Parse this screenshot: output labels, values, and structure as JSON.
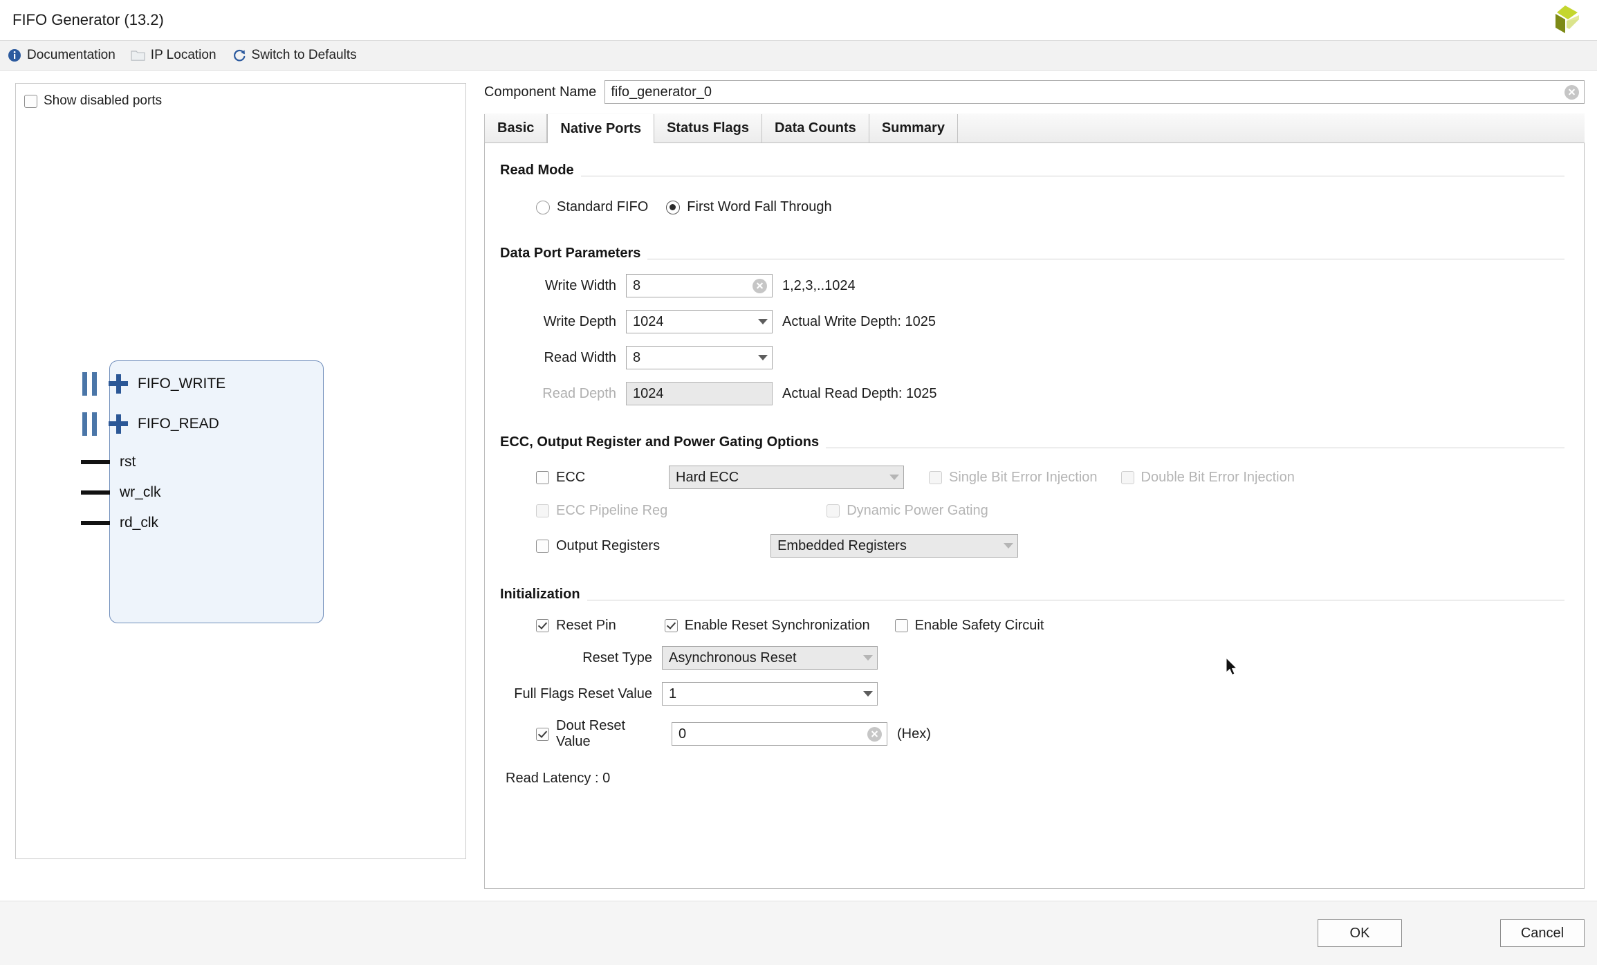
{
  "window": {
    "title": "FIFO Generator (13.2)",
    "logo_name": "xilinx-logo"
  },
  "toolbar": {
    "items": [
      {
        "label": "Documentation",
        "icon": "info-icon"
      },
      {
        "label": "IP Location",
        "icon": "folder-icon"
      },
      {
        "label": "Switch to Defaults",
        "icon": "refresh-icon"
      }
    ]
  },
  "preview": {
    "show_disabled_ports_label": "Show disabled ports",
    "show_disabled_ports_checked": false,
    "ports": [
      {
        "name": "FIFO_WRITE",
        "type": "bus"
      },
      {
        "name": "FIFO_READ",
        "type": "bus"
      },
      {
        "name": "rst",
        "type": "wire"
      },
      {
        "name": "wr_clk",
        "type": "wire"
      },
      {
        "name": "rd_clk",
        "type": "wire"
      }
    ]
  },
  "component": {
    "label": "Component Name",
    "value": "fifo_generator_0",
    "placeholder": "fifo_generator_0"
  },
  "tabs": [
    {
      "label": "Basic",
      "active": false
    },
    {
      "label": "Native Ports",
      "active": true
    },
    {
      "label": "Status Flags",
      "active": false
    },
    {
      "label": "Data Counts",
      "active": false
    },
    {
      "label": "Summary",
      "active": false
    }
  ],
  "read_mode": {
    "heading": "Read Mode",
    "options": [
      {
        "label": "Standard FIFO",
        "selected": false
      },
      {
        "label": "First Word Fall Through",
        "selected": true
      }
    ]
  },
  "data_port": {
    "heading": "Data Port Parameters",
    "write_width": {
      "label": "Write Width",
      "value": "8",
      "hint": "1,2,3,..1024"
    },
    "write_depth": {
      "label": "Write Depth",
      "value": "1024",
      "hint": "Actual Write Depth: 1025"
    },
    "read_width": {
      "label": "Read Width",
      "value": "8",
      "hint": ""
    },
    "read_depth": {
      "label": "Read Depth",
      "value": "1024",
      "hint": "Actual Read Depth: 1025",
      "disabled": true
    }
  },
  "ecc": {
    "heading": "ECC, Output Register and Power Gating Options",
    "ecc_checkbox": {
      "label": "ECC",
      "checked": false
    },
    "ecc_select": {
      "value": "Hard ECC",
      "disabled": true
    },
    "single_bit": {
      "label": "Single Bit Error Injection",
      "checked": false,
      "disabled": true
    },
    "double_bit": {
      "label": "Double Bit Error Injection",
      "checked": false,
      "disabled": true
    },
    "pipeline_reg": {
      "label": "ECC Pipeline Reg",
      "checked": false,
      "disabled": true
    },
    "dynamic_power_gating": {
      "label": "Dynamic Power Gating",
      "checked": false,
      "disabled": true
    },
    "output_registers": {
      "label": "Output Registers",
      "checked": false
    },
    "output_registers_select": {
      "value": "Embedded Registers",
      "disabled": true
    }
  },
  "initialization": {
    "heading": "Initialization",
    "reset_pin": {
      "label": "Reset Pin",
      "checked": true
    },
    "enable_reset_sync": {
      "label": "Enable Reset Synchronization",
      "checked": true
    },
    "enable_safety_circuit": {
      "label": "Enable Safety Circuit",
      "checked": false
    },
    "reset_type": {
      "label": "Reset Type",
      "value": "Asynchronous Reset",
      "disabled": true
    },
    "full_flags_reset_value": {
      "label": "Full Flags Reset Value",
      "value": "1"
    },
    "dout_reset_value": {
      "label": "Dout Reset Value",
      "checked": true,
      "value": "0",
      "unit": "(Hex)"
    },
    "read_latency": "Read Latency : 0"
  },
  "footer": {
    "ok_label": "OK",
    "cancel_label": "Cancel"
  },
  "colors": {
    "accent_blue": "#2b5796",
    "bus_blue": "#4b76a8",
    "symbol_fill": "#eef4fb",
    "symbol_border": "#6f8dbb",
    "toolbar_bg": "#f2f2f2",
    "footer_bg": "#f5f5f5",
    "logo_green": "#b5cc18",
    "logo_olive": "#7d8a16"
  }
}
